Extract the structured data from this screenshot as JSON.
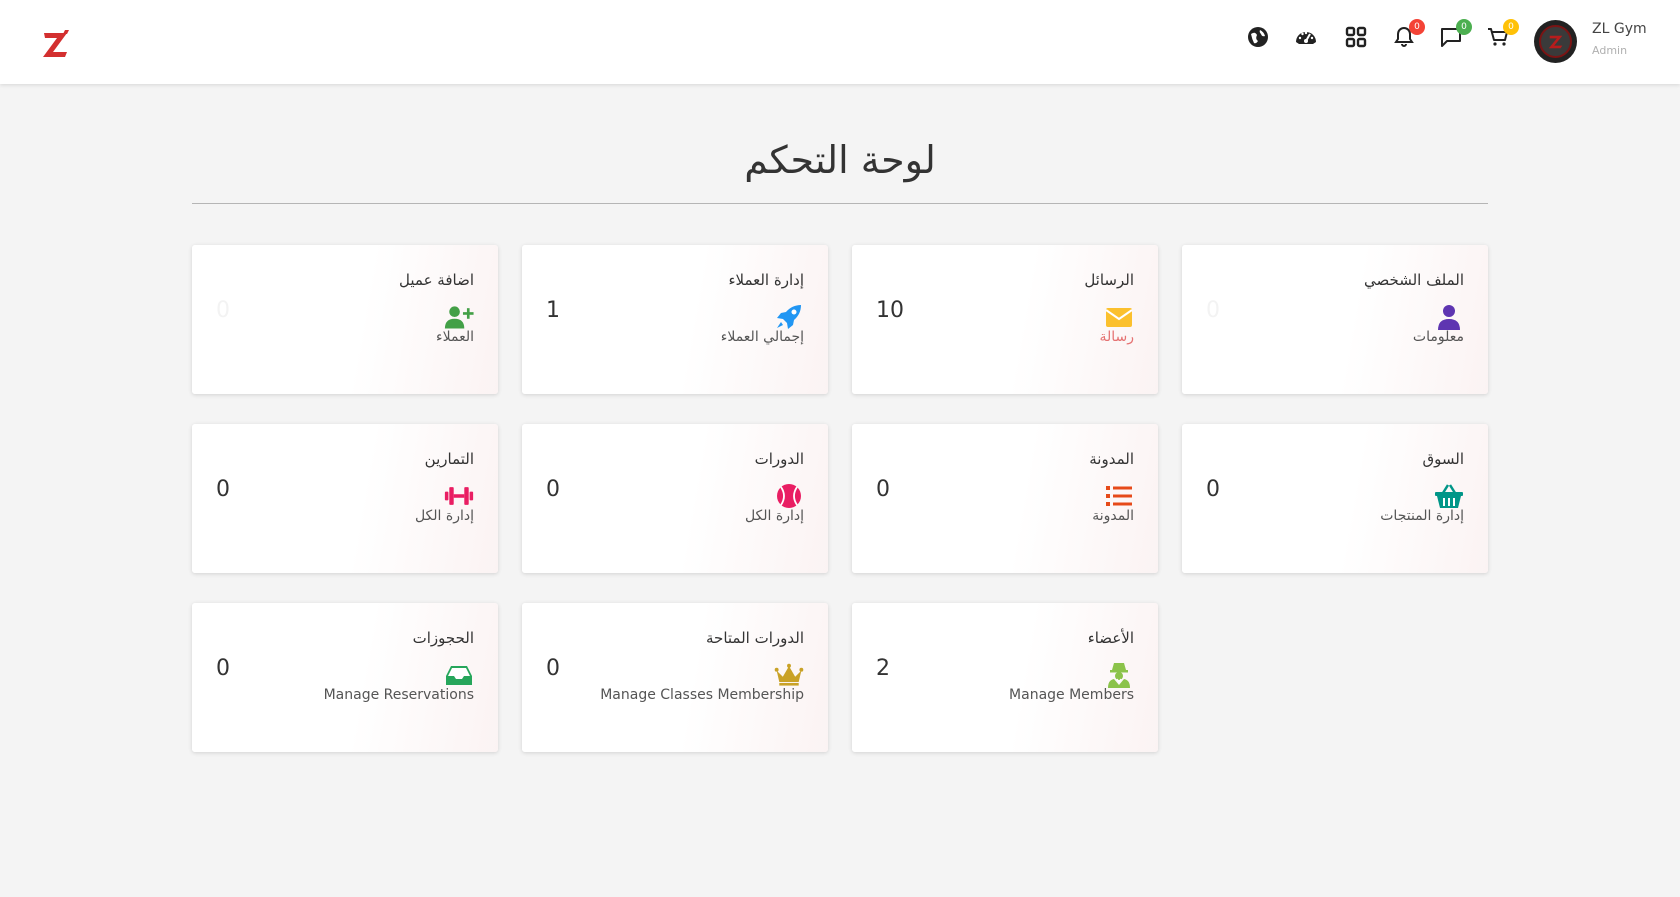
{
  "topbar": {
    "icons": [
      {
        "name": "globe-icon"
      },
      {
        "name": "speedometer-icon"
      },
      {
        "name": "grid-icon"
      },
      {
        "name": "bell-icon",
        "badge": "0",
        "badge_color": "#f44336"
      },
      {
        "name": "chat-icon",
        "badge": "0",
        "badge_color": "#4caf50"
      },
      {
        "name": "cart-icon",
        "badge": "0",
        "badge_color": "#ffc107"
      }
    ],
    "user": {
      "name": "ZL Gym",
      "role": "Admin"
    }
  },
  "page": {
    "title": "لوحة التحكم"
  },
  "colors": {
    "logo": "#d32f2f",
    "background": "#f4f4f4"
  },
  "cards": [
    {
      "title": "الملف الشخصي",
      "subtitle": "معلومات",
      "count": "0",
      "icon": "user-icon",
      "icon_color": "#5e35b1",
      "subtitle_color": "#555555",
      "count_color": "#f3f3f3"
    },
    {
      "title": "الرسائل",
      "subtitle": "رسالة",
      "count": "10",
      "icon": "envelope-icon",
      "icon_color": "#fbc02d",
      "subtitle_color": "#e57373",
      "count_color": "#333333"
    },
    {
      "title": "إدارة العملاء",
      "subtitle": "إجمالي العملاء",
      "count": "1",
      "icon": "rocket-icon",
      "icon_color": "#2196f3",
      "subtitle_color": "#555555",
      "count_color": "#333333"
    },
    {
      "title": "اضافة عميل",
      "subtitle": "العملاء",
      "count": "0",
      "icon": "user-plus-icon",
      "icon_color": "#43a047",
      "subtitle_color": "#555555",
      "count_color": "#f3f3f3"
    },
    {
      "title": "السوق",
      "subtitle": "إدارة المنتجات",
      "count": "0",
      "icon": "basket-icon",
      "icon_color": "#009688",
      "subtitle_color": "#555555",
      "count_color": "#333333"
    },
    {
      "title": "المدونة",
      "subtitle": "المدونة",
      "count": "0",
      "icon": "list-icon",
      "icon_color": "#e64a19",
      "subtitle_color": "#555555",
      "count_color": "#333333"
    },
    {
      "title": "الدورات",
      "subtitle": "إدارة الكل",
      "count": "0",
      "icon": "ball-icon",
      "icon_color": "#e91e63",
      "subtitle_color": "#555555",
      "count_color": "#333333"
    },
    {
      "title": "التمارين",
      "subtitle": "إدارة الكل",
      "count": "0",
      "icon": "dumbbell-icon",
      "icon_color": "#e91e63",
      "subtitle_color": "#555555",
      "count_color": "#333333"
    },
    {
      "title": "الأعضاء",
      "subtitle": "Manage Members",
      "count": "2",
      "icon": "member-icon",
      "icon_color": "#8bc34a",
      "subtitle_color": "#555555",
      "count_color": "#333333"
    },
    {
      "title": "الدورات المتاحة",
      "subtitle": "Manage Classes Membership",
      "count": "0",
      "icon": "crown-icon",
      "icon_color": "#c9a227",
      "subtitle_color": "#555555",
      "count_color": "#333333"
    },
    {
      "title": "الحجوزات",
      "subtitle": "Manage Reservations",
      "count": "0",
      "icon": "inbox-icon",
      "icon_color": "#26a65b",
      "subtitle_color": "#555555",
      "count_color": "#333333"
    }
  ]
}
